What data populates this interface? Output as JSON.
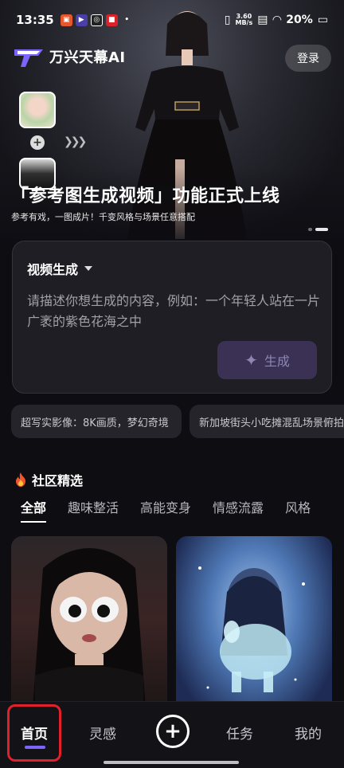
{
  "status_bar": {
    "time": "13:35",
    "net_speed_value": "3.60",
    "net_speed_unit": "MB/s",
    "battery": "20%"
  },
  "brand": {
    "name": "万兴天幕AI"
  },
  "header": {
    "login_label": "登录"
  },
  "hero": {
    "title": "「参考图生成视频」功能正式上线",
    "subtitle": "参考有戏，一图成片！千变风格与场景任意搭配"
  },
  "generator": {
    "mode": "视频生成",
    "placeholder": "请描述你想生成的内容，例如：一个年轻人站在一片广袤的紫色花海之中",
    "generate_label": "生成"
  },
  "suggestions": [
    "超写实影像：8K画质，梦幻奇境",
    "新加坡街头小吃摊混乱场景俯拍"
  ],
  "community": {
    "title": "社区精选",
    "tabs": [
      "全部",
      "趣味整活",
      "高能变身",
      "情感流露",
      "风格"
    ]
  },
  "bottom_nav": {
    "home": "首页",
    "inspiration": "灵感",
    "tasks": "任务",
    "mine": "我的"
  },
  "colors": {
    "accent": "#7a66ff",
    "generate_button_bg": "#3a3155",
    "highlight": "#e0202a"
  }
}
